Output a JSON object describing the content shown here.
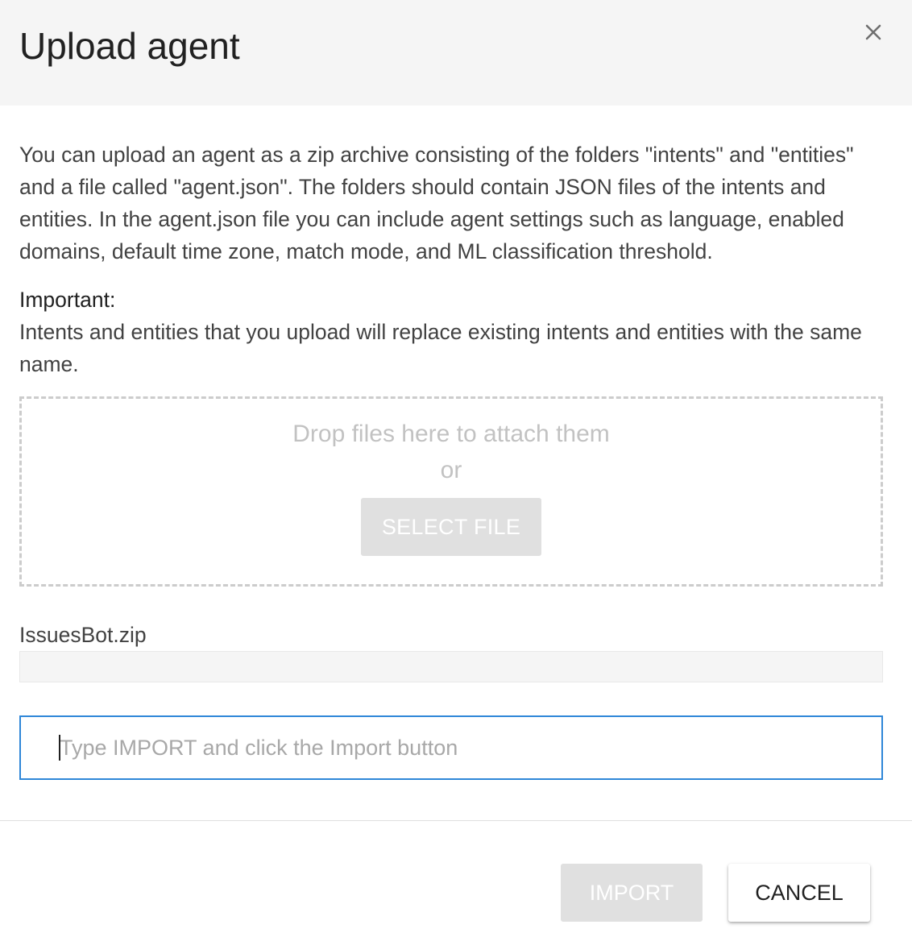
{
  "dialog": {
    "title": "Upload agent",
    "close_icon": "close-icon"
  },
  "body": {
    "description": "You can upload an agent as a zip archive consisting of the folders \"intents\" and \"entities\" and a file called \"agent.json\". The folders should contain JSON files of the intents and entities. In the agent.json file you can include agent settings such as language, enabled domains, default time zone, match mode, and ML classification threshold.",
    "important_label": "Important:",
    "important_text": "Intents and entities that you upload will replace existing intents and entities with the same name."
  },
  "dropzone": {
    "main_text": "Drop files here to attach them",
    "or_text": "or",
    "select_file_label": "SELECT FILE"
  },
  "file": {
    "name": "IssuesBot.zip"
  },
  "confirm": {
    "placeholder": "Type IMPORT and click the Import button",
    "value": ""
  },
  "footer": {
    "import_label": "IMPORT",
    "cancel_label": "CANCEL"
  },
  "colors": {
    "accent": "#2f87d8",
    "header_bg": "#f5f5f5",
    "disabled_button": "#e0e0e0"
  }
}
